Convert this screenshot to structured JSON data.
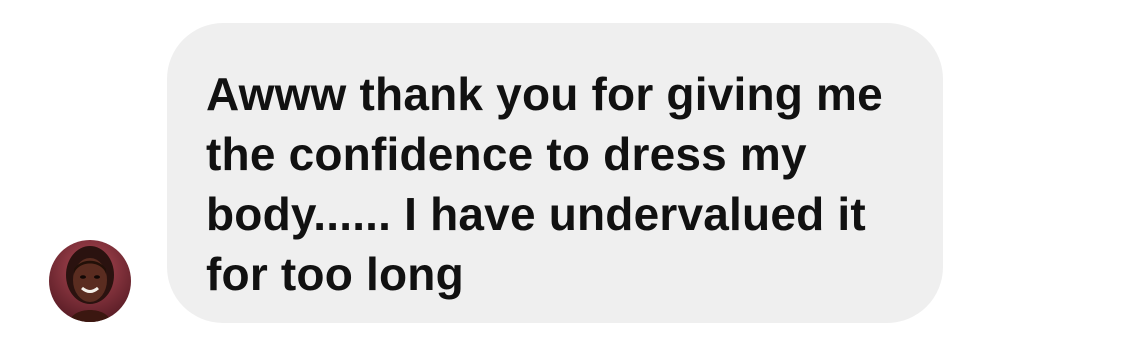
{
  "message": {
    "text": "Awww thank you for giving me\nthe confidence to dress my\nbody...... I have undervalued it\nfor too long"
  },
  "sender": {
    "avatar_icon": "profile-photo"
  },
  "colors": {
    "bubble_background": "#efefef",
    "message_text": "#111111",
    "page_background": "#ffffff"
  }
}
